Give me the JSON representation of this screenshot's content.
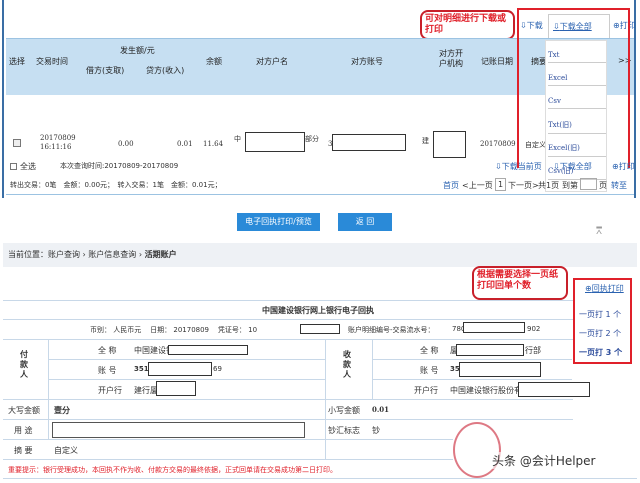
{
  "top": {
    "annotation": "可对明细进行下载或打印",
    "toolbar": {
      "download": "下载",
      "download_all": "下载全部",
      "print": "打印"
    },
    "dropdown": [
      "Txt",
      "Excel",
      "Csv",
      "Txt(旧)",
      "Excel(旧)",
      "Csv(旧)"
    ],
    "headers": {
      "select": "选择",
      "time": "交易时间",
      "amount_group": "发生额/元",
      "debit": "借方(支取)",
      "credit": "贷方(收入)",
      "balance": "余额",
      "party_name": "对方户名",
      "party_account": "对方账号",
      "party_bank": "对方开户机构",
      "post_date": "记账日期",
      "summary": "摘要",
      "more": ">>"
    },
    "row": {
      "time_date": "20170809",
      "time_clock": "16:11:16",
      "debit": "0.00",
      "credit": "0.01",
      "balance": "11.64",
      "party_name_prefix": "中",
      "party_name_suffix": "部分",
      "party_account_prefix": "3",
      "party_bank_prefix": "建",
      "post_date": "20170809",
      "summary": "自定义"
    },
    "footer": {
      "select_all": "全选",
      "query_time": "本次查询时间:20170809-20170809",
      "download_page": "下载当前页",
      "download_all": "下载全部",
      "print": "打印",
      "stats": "转出交易：0笔　金额：0.00元；　转入交易：1笔　金额：0.01元；",
      "pager": {
        "first": "首页",
        "prev": "<上一页",
        "page": "1",
        "next": "下一页>",
        "total": "共1页",
        "goto": "到第",
        "page_unit": "页",
        "go": "转至"
      }
    },
    "buttons": {
      "receipt": "电子回执打印/预览",
      "back": "返 回"
    }
  },
  "bottom": {
    "breadcrumb": {
      "prefix": "当前位置：",
      "items": [
        "账户查询",
        "账户信息查询",
        "活期账户"
      ]
    },
    "annotation": "根据需要选择一页纸打印回单个数",
    "receipt_print": "回执打印",
    "menu": [
      "一页打 1 个",
      "一页打 2 个",
      "一页打 3 个"
    ],
    "receipt": {
      "title": "中国建设银行网上银行电子回执",
      "currency_label": "币别：",
      "currency": "人民币元",
      "date_label": "日期：",
      "date": "20170809",
      "voucher_label": "凭证号：",
      "voucher_prefix": "10",
      "serial_label": "账户明细编号-交易流水号：",
      "serial_prefix": "780",
      "serial_suffix": "902",
      "payer": "付款人",
      "payee": "收款人",
      "name_label": "全 称",
      "account_label": "账 号",
      "bank_label": "开户行",
      "payer_name_prefix": "中国建设银",
      "payer_account_prefix": "3510",
      "payer_account_suffix": "69",
      "payer_bank_prefix": "建行厦",
      "payee_name_prefix": "厦",
      "payee_name_suffix": "行部",
      "payee_account_prefix": "35",
      "payee_bank_prefix": "中国建设银行股份有",
      "amount_words_label": "大写金额",
      "amount_words": "壹分",
      "amount_label": "小写金额",
      "amount": "0.01",
      "purpose_label": "用 途",
      "cash_label": "钞汇标志",
      "cash": "钞",
      "summary_label": "摘 要",
      "summary": "自定义",
      "notice": "重要提示：银行受理成功，本回执不作为收、付款方交易的最终依据，正式回单请在交易成功第二日打印。"
    },
    "watermark": "头条 @会计Helper"
  }
}
